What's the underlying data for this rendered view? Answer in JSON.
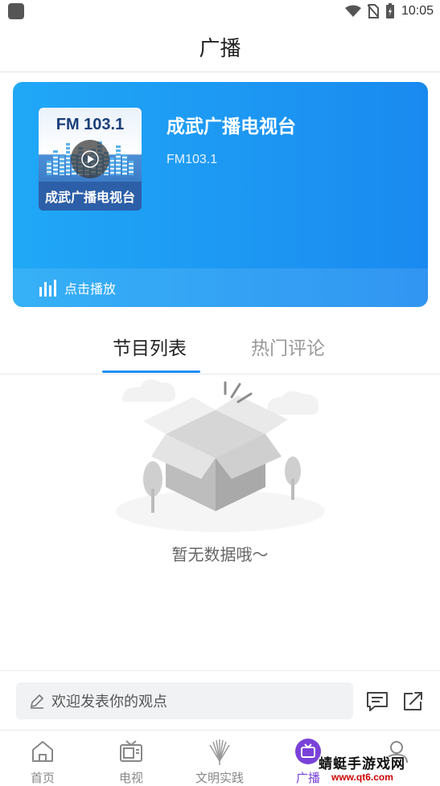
{
  "status_bar": {
    "time": "10:05"
  },
  "header": {
    "title": "广播"
  },
  "station": {
    "thumb_fm": "FM 103.1",
    "thumb_name": "成武广播电视台",
    "name": "成武广播电视台",
    "frequency": "FM103.1",
    "play_label": "点击播放"
  },
  "tabs": [
    {
      "label": "节目列表",
      "active": true
    },
    {
      "label": "热门评论",
      "active": false
    }
  ],
  "empty": {
    "message": "暂无数据哦～"
  },
  "comment": {
    "placeholder": "欢迎发表你的观点"
  },
  "nav": {
    "items": [
      {
        "label": "首页",
        "icon": "home-icon"
      },
      {
        "label": "电视",
        "icon": "tv-icon"
      },
      {
        "label": "文明实践",
        "icon": "civilization-icon"
      },
      {
        "label": "广播",
        "icon": "radio-icon",
        "active": true
      },
      {
        "label": "",
        "icon": "user-icon"
      }
    ]
  },
  "watermark": {
    "title": "蜻蜓手游戏网",
    "url": "www.qt6.com"
  },
  "colors": {
    "accent": "#1c8ef2",
    "active_nav": "#7a43d8",
    "card_start": "#20a8f6",
    "card_end": "#1a8af0"
  }
}
